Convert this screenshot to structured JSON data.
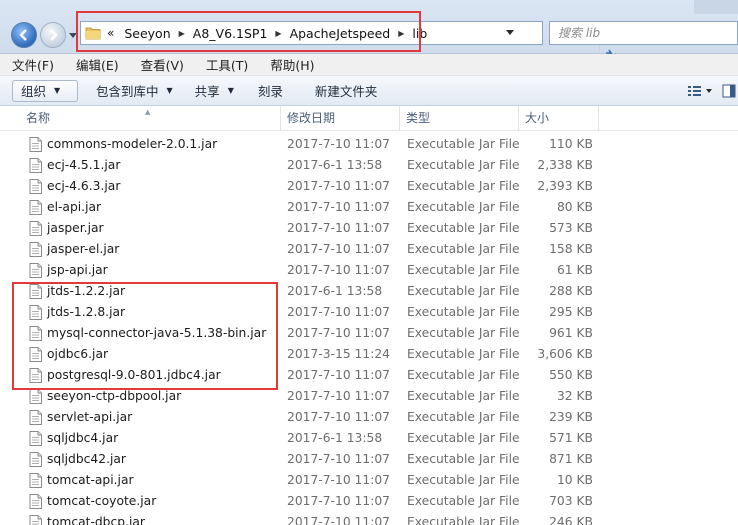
{
  "address": {
    "lead": "«",
    "crumbs": [
      "Seeyon",
      "A8_V6.1SP1",
      "ApacheJetspeed",
      "lib"
    ]
  },
  "search": {
    "placeholder": "搜索 lib"
  },
  "menu": {
    "items": [
      "文件(F)",
      "编辑(E)",
      "查看(V)",
      "工具(T)",
      "帮助(H)"
    ]
  },
  "toolbar": {
    "organize": "组织",
    "include_in_library": "包含到库中",
    "share": "共享",
    "burn": "刻录",
    "new_folder": "新建文件夹"
  },
  "columns": {
    "name": "名称",
    "date": "修改日期",
    "type": "类型",
    "size": "大小"
  },
  "files": [
    {
      "name": "commons-modeler-2.0.1.jar",
      "date": "2017-7-10 11:07",
      "type": "Executable Jar File",
      "size": "110 KB"
    },
    {
      "name": "ecj-4.5.1.jar",
      "date": "2017-6-1 13:58",
      "type": "Executable Jar File",
      "size": "2,338 KB"
    },
    {
      "name": "ecj-4.6.3.jar",
      "date": "2017-7-10 11:07",
      "type": "Executable Jar File",
      "size": "2,393 KB"
    },
    {
      "name": "el-api.jar",
      "date": "2017-7-10 11:07",
      "type": "Executable Jar File",
      "size": "80 KB"
    },
    {
      "name": "jasper.jar",
      "date": "2017-7-10 11:07",
      "type": "Executable Jar File",
      "size": "573 KB"
    },
    {
      "name": "jasper-el.jar",
      "date": "2017-7-10 11:07",
      "type": "Executable Jar File",
      "size": "158 KB"
    },
    {
      "name": "jsp-api.jar",
      "date": "2017-7-10 11:07",
      "type": "Executable Jar File",
      "size": "61 KB"
    },
    {
      "name": "jtds-1.2.2.jar",
      "date": "2017-6-1 13:58",
      "type": "Executable Jar File",
      "size": "288 KB"
    },
    {
      "name": "jtds-1.2.8.jar",
      "date": "2017-7-10 11:07",
      "type": "Executable Jar File",
      "size": "295 KB"
    },
    {
      "name": "mysql-connector-java-5.1.38-bin.jar",
      "date": "2017-7-10 11:07",
      "type": "Executable Jar File",
      "size": "961 KB"
    },
    {
      "name": "ojdbc6.jar",
      "date": "2017-3-15 11:24",
      "type": "Executable Jar File",
      "size": "3,606 KB"
    },
    {
      "name": "postgresql-9.0-801.jdbc4.jar",
      "date": "2017-7-10 11:07",
      "type": "Executable Jar File",
      "size": "550 KB"
    },
    {
      "name": "seeyon-ctp-dbpool.jar",
      "date": "2017-7-10 11:07",
      "type": "Executable Jar File",
      "size": "32 KB"
    },
    {
      "name": "servlet-api.jar",
      "date": "2017-7-10 11:07",
      "type": "Executable Jar File",
      "size": "239 KB"
    },
    {
      "name": "sqljdbc4.jar",
      "date": "2017-6-1 13:58",
      "type": "Executable Jar File",
      "size": "571 KB"
    },
    {
      "name": "sqljdbc42.jar",
      "date": "2017-7-10 11:07",
      "type": "Executable Jar File",
      "size": "871 KB"
    },
    {
      "name": "tomcat-api.jar",
      "date": "2017-7-10 11:07",
      "type": "Executable Jar File",
      "size": "10 KB"
    },
    {
      "name": "tomcat-coyote.jar",
      "date": "2017-7-10 11:07",
      "type": "Executable Jar File",
      "size": "703 KB"
    },
    {
      "name": "tomcat-dbcp.jar",
      "date": "2017-7-10 11:07",
      "type": "Executable Jar File",
      "size": "246 KB"
    }
  ],
  "colors": {
    "highlight": "#e23a3a",
    "address_bg": "#dbe6f4"
  },
  "icons": {
    "file": "jar-file-icon",
    "folder": "folder-icon",
    "refresh": "refresh-icon",
    "back": "back-arrow-icon",
    "forward": "forward-arrow-icon"
  }
}
